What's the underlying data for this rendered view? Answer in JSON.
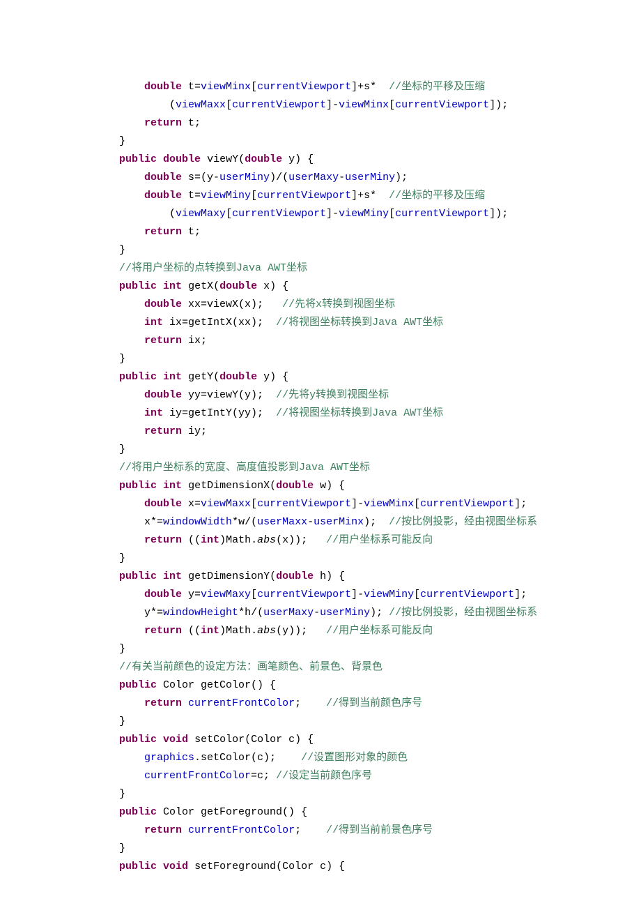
{
  "lines": [
    {
      "indent": 2,
      "tokens": [
        {
          "t": "kw",
          "s": "double"
        },
        {
          "t": "plain",
          "s": " t="
        },
        {
          "t": "fld",
          "s": "viewMinx"
        },
        {
          "t": "plain",
          "s": "["
        },
        {
          "t": "fld",
          "s": "currentViewport"
        },
        {
          "t": "plain",
          "s": "]+s*  "
        },
        {
          "t": "cmt",
          "s": "//坐标的平移及压缩"
        }
      ]
    },
    {
      "indent": 3,
      "tokens": [
        {
          "t": "plain",
          "s": "("
        },
        {
          "t": "fld",
          "s": "viewMaxx"
        },
        {
          "t": "plain",
          "s": "["
        },
        {
          "t": "fld",
          "s": "currentViewport"
        },
        {
          "t": "plain",
          "s": "]-"
        },
        {
          "t": "fld",
          "s": "viewMinx"
        },
        {
          "t": "plain",
          "s": "["
        },
        {
          "t": "fld",
          "s": "currentViewport"
        },
        {
          "t": "plain",
          "s": "]);"
        }
      ]
    },
    {
      "indent": 2,
      "tokens": [
        {
          "t": "kw",
          "s": "return"
        },
        {
          "t": "plain",
          "s": " t;"
        }
      ]
    },
    {
      "indent": 1,
      "tokens": [
        {
          "t": "plain",
          "s": "}"
        }
      ]
    },
    {
      "indent": 1,
      "tokens": [
        {
          "t": "kw",
          "s": "public"
        },
        {
          "t": "plain",
          "s": " "
        },
        {
          "t": "kw",
          "s": "double"
        },
        {
          "t": "plain",
          "s": " viewY("
        },
        {
          "t": "kw",
          "s": "double"
        },
        {
          "t": "plain",
          "s": " y) {"
        }
      ]
    },
    {
      "indent": 2,
      "tokens": [
        {
          "t": "kw",
          "s": "double"
        },
        {
          "t": "plain",
          "s": " s=(y-"
        },
        {
          "t": "fld",
          "s": "userMiny"
        },
        {
          "t": "plain",
          "s": ")/("
        },
        {
          "t": "fld",
          "s": "userMaxy"
        },
        {
          "t": "plain",
          "s": "-"
        },
        {
          "t": "fld",
          "s": "userMiny"
        },
        {
          "t": "plain",
          "s": ");"
        }
      ]
    },
    {
      "indent": 2,
      "tokens": [
        {
          "t": "kw",
          "s": "double"
        },
        {
          "t": "plain",
          "s": " t="
        },
        {
          "t": "fld",
          "s": "viewMiny"
        },
        {
          "t": "plain",
          "s": "["
        },
        {
          "t": "fld",
          "s": "currentViewport"
        },
        {
          "t": "plain",
          "s": "]+s*  "
        },
        {
          "t": "cmt",
          "s": "//坐标的平移及压缩"
        }
      ]
    },
    {
      "indent": 3,
      "tokens": [
        {
          "t": "plain",
          "s": "("
        },
        {
          "t": "fld",
          "s": "viewMaxy"
        },
        {
          "t": "plain",
          "s": "["
        },
        {
          "t": "fld",
          "s": "currentViewport"
        },
        {
          "t": "plain",
          "s": "]-"
        },
        {
          "t": "fld",
          "s": "viewMiny"
        },
        {
          "t": "plain",
          "s": "["
        },
        {
          "t": "fld",
          "s": "currentViewport"
        },
        {
          "t": "plain",
          "s": "]);"
        }
      ]
    },
    {
      "indent": 2,
      "tokens": [
        {
          "t": "kw",
          "s": "return"
        },
        {
          "t": "plain",
          "s": " t;"
        }
      ]
    },
    {
      "indent": 1,
      "tokens": [
        {
          "t": "plain",
          "s": "}"
        }
      ]
    },
    {
      "indent": 1,
      "tokens": [
        {
          "t": "cmt",
          "s": "//将用户坐标的点转换到Java AWT坐标"
        }
      ]
    },
    {
      "indent": 1,
      "tokens": [
        {
          "t": "kw",
          "s": "public"
        },
        {
          "t": "plain",
          "s": " "
        },
        {
          "t": "kw",
          "s": "int"
        },
        {
          "t": "plain",
          "s": " getX("
        },
        {
          "t": "kw",
          "s": "double"
        },
        {
          "t": "plain",
          "s": " x) {"
        }
      ]
    },
    {
      "indent": 2,
      "tokens": [
        {
          "t": "kw",
          "s": "double"
        },
        {
          "t": "plain",
          "s": " xx=viewX(x);   "
        },
        {
          "t": "cmt",
          "s": "//先将x转换到视图坐标"
        }
      ]
    },
    {
      "indent": 2,
      "tokens": [
        {
          "t": "kw",
          "s": "int"
        },
        {
          "t": "plain",
          "s": " ix=getIntX(xx);  "
        },
        {
          "t": "cmt",
          "s": "//将视图坐标转换到Java AWT坐标"
        }
      ]
    },
    {
      "indent": 2,
      "tokens": [
        {
          "t": "kw",
          "s": "return"
        },
        {
          "t": "plain",
          "s": " ix;"
        }
      ]
    },
    {
      "indent": 1,
      "tokens": [
        {
          "t": "plain",
          "s": "}"
        }
      ]
    },
    {
      "indent": 1,
      "tokens": [
        {
          "t": "kw",
          "s": "public"
        },
        {
          "t": "plain",
          "s": " "
        },
        {
          "t": "kw",
          "s": "int"
        },
        {
          "t": "plain",
          "s": " getY("
        },
        {
          "t": "kw",
          "s": "double"
        },
        {
          "t": "plain",
          "s": " y) {"
        }
      ]
    },
    {
      "indent": 2,
      "tokens": [
        {
          "t": "kw",
          "s": "double"
        },
        {
          "t": "plain",
          "s": " yy=viewY(y);  "
        },
        {
          "t": "cmt",
          "s": "//先将y转换到视图坐标"
        }
      ]
    },
    {
      "indent": 2,
      "tokens": [
        {
          "t": "kw",
          "s": "int"
        },
        {
          "t": "plain",
          "s": " iy=getIntY(yy);  "
        },
        {
          "t": "cmt",
          "s": "//将视图坐标转换到Java AWT坐标"
        }
      ]
    },
    {
      "indent": 2,
      "tokens": [
        {
          "t": "kw",
          "s": "return"
        },
        {
          "t": "plain",
          "s": " iy;"
        }
      ]
    },
    {
      "indent": 1,
      "tokens": [
        {
          "t": "plain",
          "s": "}"
        }
      ]
    },
    {
      "indent": 1,
      "tokens": [
        {
          "t": "cmt",
          "s": "//将用户坐标系的宽度、高度值投影到Java AWT坐标"
        }
      ]
    },
    {
      "indent": 1,
      "tokens": [
        {
          "t": "kw",
          "s": "public"
        },
        {
          "t": "plain",
          "s": " "
        },
        {
          "t": "kw",
          "s": "int"
        },
        {
          "t": "plain",
          "s": " getDimensionX("
        },
        {
          "t": "kw",
          "s": "double"
        },
        {
          "t": "plain",
          "s": " w) {"
        }
      ]
    },
    {
      "indent": 2,
      "tokens": [
        {
          "t": "kw",
          "s": "double"
        },
        {
          "t": "plain",
          "s": " x="
        },
        {
          "t": "fld",
          "s": "viewMaxx"
        },
        {
          "t": "plain",
          "s": "["
        },
        {
          "t": "fld",
          "s": "currentViewport"
        },
        {
          "t": "plain",
          "s": "]-"
        },
        {
          "t": "fld",
          "s": "viewMinx"
        },
        {
          "t": "plain",
          "s": "["
        },
        {
          "t": "fld",
          "s": "currentViewport"
        },
        {
          "t": "plain",
          "s": "];"
        }
      ]
    },
    {
      "indent": 2,
      "tokens": [
        {
          "t": "plain",
          "s": "x*="
        },
        {
          "t": "fld",
          "s": "windowWidth"
        },
        {
          "t": "plain",
          "s": "*w/("
        },
        {
          "t": "fld",
          "s": "userMaxx"
        },
        {
          "t": "plain",
          "s": "-"
        },
        {
          "t": "fld",
          "s": "userMinx"
        },
        {
          "t": "plain",
          "s": ");  "
        },
        {
          "t": "cmt",
          "s": "//按比例投影，经由视图坐标系"
        }
      ]
    },
    {
      "indent": 2,
      "tokens": [
        {
          "t": "kw",
          "s": "return"
        },
        {
          "t": "plain",
          "s": " (("
        },
        {
          "t": "kw",
          "s": "int"
        },
        {
          "t": "plain",
          "s": ")Math."
        },
        {
          "t": "plain static",
          "s": "abs"
        },
        {
          "t": "plain",
          "s": "(x));   "
        },
        {
          "t": "cmt",
          "s": "//用户坐标系可能反向"
        }
      ]
    },
    {
      "indent": 1,
      "tokens": [
        {
          "t": "plain",
          "s": "}"
        }
      ]
    },
    {
      "indent": 1,
      "tokens": [
        {
          "t": "kw",
          "s": "public"
        },
        {
          "t": "plain",
          "s": " "
        },
        {
          "t": "kw",
          "s": "int"
        },
        {
          "t": "plain",
          "s": " getDimensionY("
        },
        {
          "t": "kw",
          "s": "double"
        },
        {
          "t": "plain",
          "s": " h) {"
        }
      ]
    },
    {
      "indent": 2,
      "tokens": [
        {
          "t": "kw",
          "s": "double"
        },
        {
          "t": "plain",
          "s": " y="
        },
        {
          "t": "fld",
          "s": "viewMaxy"
        },
        {
          "t": "plain",
          "s": "["
        },
        {
          "t": "fld",
          "s": "currentViewport"
        },
        {
          "t": "plain",
          "s": "]-"
        },
        {
          "t": "fld",
          "s": "viewMiny"
        },
        {
          "t": "plain",
          "s": "["
        },
        {
          "t": "fld",
          "s": "currentViewport"
        },
        {
          "t": "plain",
          "s": "];"
        }
      ]
    },
    {
      "indent": 2,
      "tokens": [
        {
          "t": "plain",
          "s": "y*="
        },
        {
          "t": "fld",
          "s": "windowHeight"
        },
        {
          "t": "plain",
          "s": "*h/("
        },
        {
          "t": "fld",
          "s": "userMaxy"
        },
        {
          "t": "plain",
          "s": "-"
        },
        {
          "t": "fld",
          "s": "userMiny"
        },
        {
          "t": "plain",
          "s": "); "
        },
        {
          "t": "cmt",
          "s": "//按比例投影，经由视图坐标系"
        }
      ]
    },
    {
      "indent": 2,
      "tokens": [
        {
          "t": "kw",
          "s": "return"
        },
        {
          "t": "plain",
          "s": " (("
        },
        {
          "t": "kw",
          "s": "int"
        },
        {
          "t": "plain",
          "s": ")Math."
        },
        {
          "t": "plain static",
          "s": "abs"
        },
        {
          "t": "plain",
          "s": "(y));   "
        },
        {
          "t": "cmt",
          "s": "//用户坐标系可能反向"
        }
      ]
    },
    {
      "indent": 1,
      "tokens": [
        {
          "t": "plain",
          "s": "}"
        }
      ]
    },
    {
      "indent": 1,
      "tokens": [
        {
          "t": "cmt",
          "s": "//有关当前颜色的设定方法：画笔颜色、前景色、背景色"
        }
      ]
    },
    {
      "indent": 1,
      "tokens": [
        {
          "t": "kw",
          "s": "public"
        },
        {
          "t": "plain",
          "s": " Color getColor() {"
        }
      ]
    },
    {
      "indent": 2,
      "tokens": [
        {
          "t": "kw",
          "s": "return"
        },
        {
          "t": "plain",
          "s": " "
        },
        {
          "t": "fld",
          "s": "currentFrontColor"
        },
        {
          "t": "plain",
          "s": ";    "
        },
        {
          "t": "cmt",
          "s": "//得到当前颜色序号"
        }
      ]
    },
    {
      "indent": 1,
      "tokens": [
        {
          "t": "plain",
          "s": "}"
        }
      ]
    },
    {
      "indent": 1,
      "tokens": [
        {
          "t": "kw",
          "s": "public"
        },
        {
          "t": "plain",
          "s": " "
        },
        {
          "t": "kw",
          "s": "void"
        },
        {
          "t": "plain",
          "s": " setColor(Color c) {"
        }
      ]
    },
    {
      "indent": 2,
      "tokens": [
        {
          "t": "fld",
          "s": "graphics"
        },
        {
          "t": "plain",
          "s": ".setColor(c);    "
        },
        {
          "t": "cmt",
          "s": "//设置图形对象的颜色"
        }
      ]
    },
    {
      "indent": 2,
      "tokens": [
        {
          "t": "fld",
          "s": "currentFrontColor"
        },
        {
          "t": "plain",
          "s": "=c; "
        },
        {
          "t": "cmt",
          "s": "//设定当前颜色序号"
        }
      ]
    },
    {
      "indent": 1,
      "tokens": [
        {
          "t": "plain",
          "s": "}"
        }
      ]
    },
    {
      "indent": 1,
      "tokens": [
        {
          "t": "kw",
          "s": "public"
        },
        {
          "t": "plain",
          "s": " Color getForeground() {"
        }
      ]
    },
    {
      "indent": 2,
      "tokens": [
        {
          "t": "kw",
          "s": "return"
        },
        {
          "t": "plain",
          "s": " "
        },
        {
          "t": "fld",
          "s": "currentFrontColor"
        },
        {
          "t": "plain",
          "s": ";    "
        },
        {
          "t": "cmt",
          "s": "//得到当前前景色序号"
        }
      ]
    },
    {
      "indent": 1,
      "tokens": [
        {
          "t": "plain",
          "s": "}"
        }
      ]
    },
    {
      "indent": 1,
      "tokens": [
        {
          "t": "kw",
          "s": "public"
        },
        {
          "t": "plain",
          "s": " "
        },
        {
          "t": "kw",
          "s": "void"
        },
        {
          "t": "plain",
          "s": " setForeground(Color c) {"
        }
      ]
    }
  ],
  "indent_unit": "    "
}
